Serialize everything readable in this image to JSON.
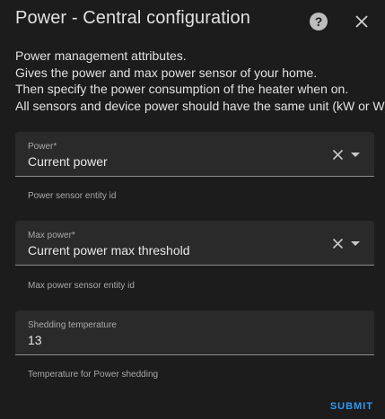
{
  "dialog": {
    "title": "Power - Central configuration",
    "help_icon_glyph": "?",
    "help_icon": "help-circle-icon",
    "close_icon": "close-icon"
  },
  "description": {
    "lines": [
      "Power management attributes.",
      "Gives the power and max power sensor of your home.",
      "Then specify the power consumption of the heater when on.",
      "All sensors and device power should have the same unit (kW or W)."
    ]
  },
  "fields": {
    "power": {
      "label": "Power*",
      "value": "Current power",
      "helper": "Power sensor entity id"
    },
    "max_power": {
      "label": "Max power*",
      "value": "Current power max threshold",
      "helper": "Max power sensor entity id"
    },
    "shedding_temperature": {
      "label": "Shedding temperature",
      "value": "13",
      "helper": "Temperature for Power shedding"
    }
  },
  "actions": {
    "submit_label": "SUBMIT"
  },
  "colors": {
    "background": "#1c1c1c",
    "field_background": "#2a2a2a",
    "accent": "#2b9af3"
  }
}
